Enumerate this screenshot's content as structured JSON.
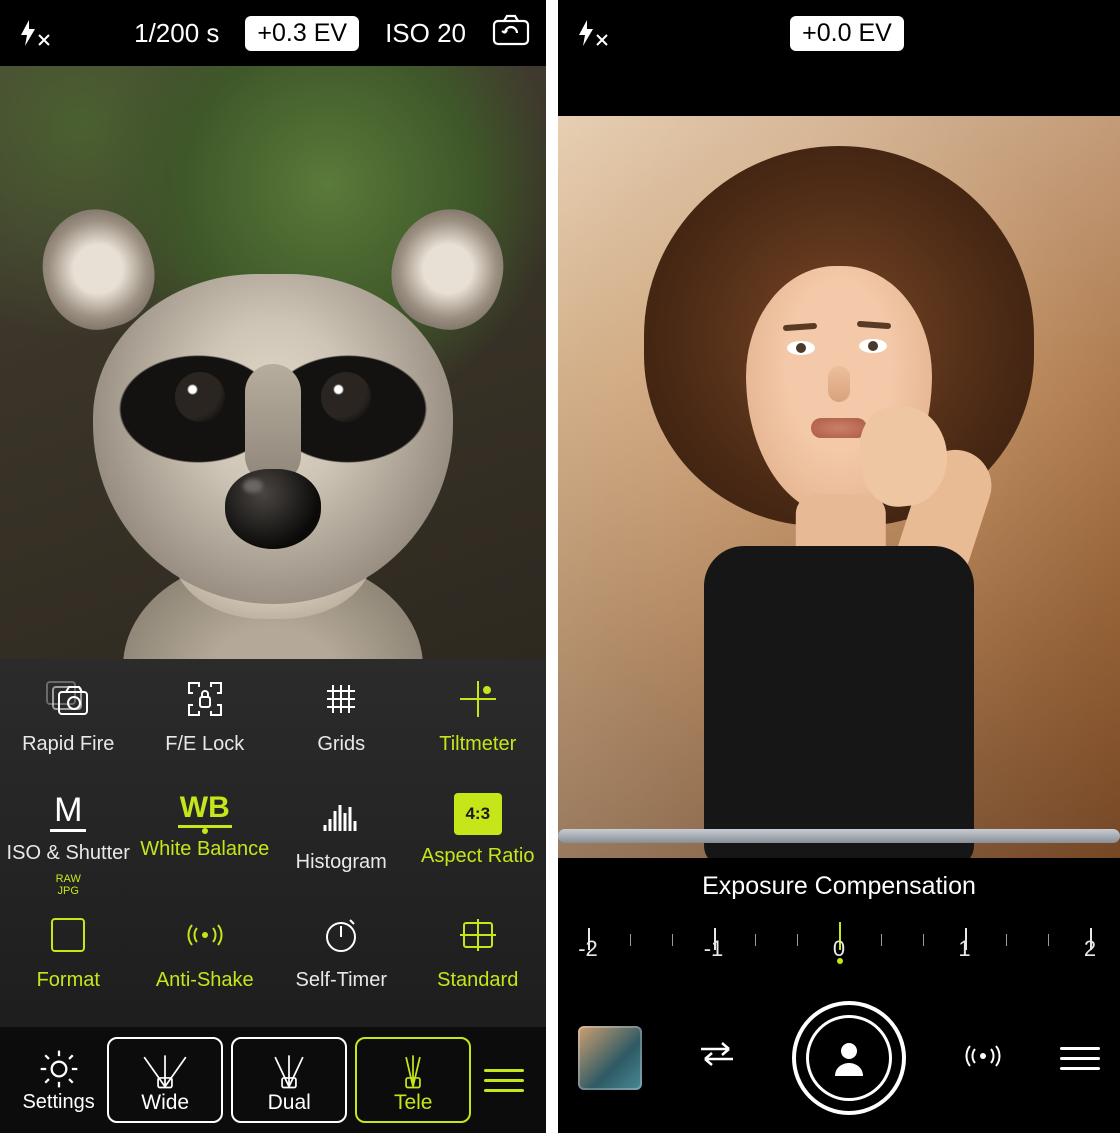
{
  "left": {
    "top": {
      "flash": "off",
      "shutter_speed": "1/200 s",
      "ev_pill": "+0.3 EV",
      "iso": "ISO 20"
    },
    "tools": {
      "row1": [
        {
          "id": "rapid-fire",
          "label": "Rapid Fire",
          "active": false
        },
        {
          "id": "fe-lock",
          "label": "F/E Lock",
          "active": false
        },
        {
          "id": "grids",
          "label": "Grids",
          "active": false
        },
        {
          "id": "tiltmeter",
          "label": "Tiltmeter",
          "active": true
        }
      ],
      "row2": [
        {
          "id": "iso-shutter",
          "label": "ISO & Shutter",
          "active": false,
          "badge": "M"
        },
        {
          "id": "white-balance",
          "label": "White Balance",
          "active": true,
          "badge": "WB"
        },
        {
          "id": "histogram",
          "label": "Histogram",
          "active": false
        },
        {
          "id": "aspect-ratio",
          "label": "Aspect Ratio",
          "active": true,
          "badge": "4:3"
        }
      ],
      "row3": [
        {
          "id": "format",
          "label": "Format",
          "active": true,
          "badge": "RAW JPG"
        },
        {
          "id": "anti-shake",
          "label": "Anti-Shake",
          "active": true
        },
        {
          "id": "self-timer",
          "label": "Self-Timer",
          "active": false
        },
        {
          "id": "standard",
          "label": "Standard",
          "active": true
        }
      ]
    },
    "dock": {
      "settings_label": "Settings",
      "lenses": [
        {
          "id": "wide",
          "label": "Wide",
          "selected": false
        },
        {
          "id": "dual",
          "label": "Dual",
          "selected": false
        },
        {
          "id": "tele",
          "label": "Tele",
          "selected": true
        }
      ]
    }
  },
  "right": {
    "top": {
      "flash": "off",
      "ev_pill": "+0.0 EV"
    },
    "exp_label": "Exposure Compensation",
    "scale": {
      "min": -2,
      "max": 2,
      "step_minor": 0.3333,
      "current": 0,
      "major_labels": [
        "-2",
        "-1",
        "0",
        "1",
        "2"
      ]
    },
    "dock": {
      "mode": "portrait"
    }
  },
  "colors": {
    "accent": "#c6e619"
  }
}
